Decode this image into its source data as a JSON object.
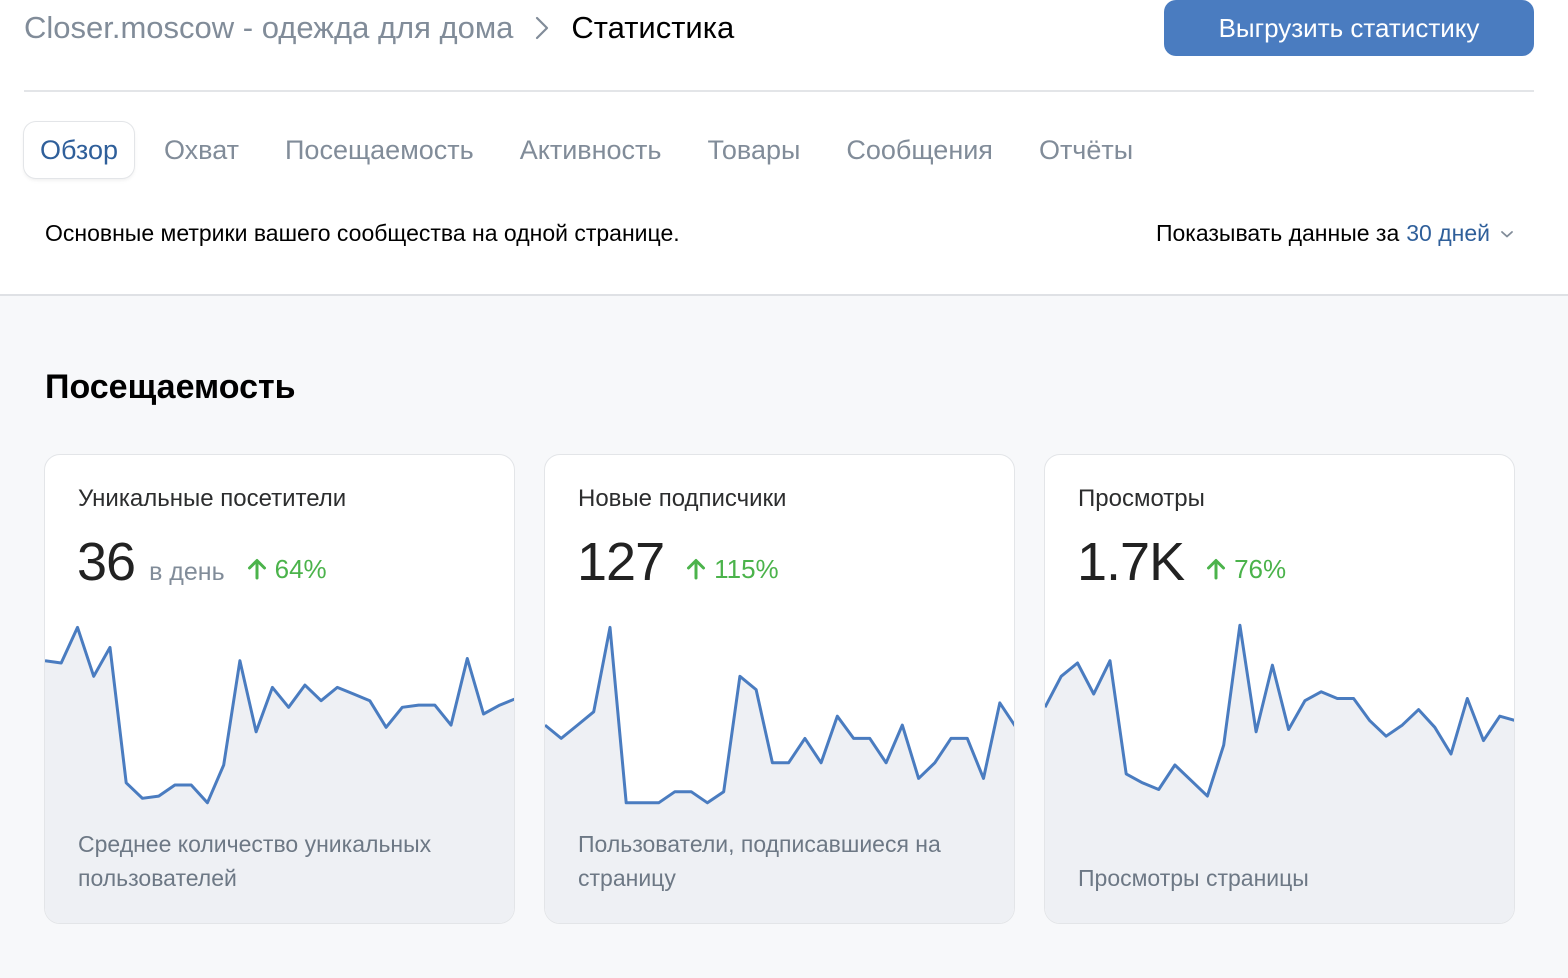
{
  "breadcrumb": {
    "parent": "Closer.moscow - одежда для дома",
    "current": "Статистика"
  },
  "export_button": "Выгрузить статистику",
  "tabs": [
    {
      "label": "Обзор",
      "active": true
    },
    {
      "label": "Охват",
      "active": false
    },
    {
      "label": "Посещаемость",
      "active": false
    },
    {
      "label": "Активность",
      "active": false
    },
    {
      "label": "Товары",
      "active": false
    },
    {
      "label": "Сообщения",
      "active": false
    },
    {
      "label": "Отчёты",
      "active": false
    }
  ],
  "subtitle": "Основные метрики вашего сообщества на одной странице.",
  "period": {
    "label": "Показывать данные за",
    "value": "30 дней"
  },
  "section_title": "Посещаемость",
  "colors": {
    "accent": "#4a7cc0",
    "positive": "#4bb34b",
    "line": "#4a7cc0",
    "fill": "#eef0f4"
  },
  "cards": [
    {
      "title": "Уникальные посетители",
      "value": "36",
      "unit": "в день",
      "change": "64%",
      "description": "Среднее количество уникальных пользователей"
    },
    {
      "title": "Новые подписчики",
      "value": "127",
      "unit": "",
      "change": "115%",
      "description": "Пользователи, подписавшиеся на страницу"
    },
    {
      "title": "Просмотры",
      "value": "1.7K",
      "unit": "",
      "change": "76%",
      "description": "Просмотры страницы"
    }
  ],
  "chart_data": [
    {
      "type": "area",
      "series": [
        {
          "values": [
            65,
            64,
            80,
            58,
            71,
            10,
            3,
            4,
            9,
            9,
            1,
            18,
            65,
            33,
            53,
            44,
            54,
            47,
            53,
            50,
            47,
            35,
            44,
            45,
            45,
            36,
            66,
            41,
            45,
            48
          ]
        }
      ]
    },
    {
      "type": "area",
      "series": [
        {
          "values": [
            36,
            30,
            36,
            42,
            80,
            1,
            1,
            1,
            6,
            6,
            1,
            6,
            58,
            52,
            19,
            19,
            30,
            19,
            40,
            30,
            30,
            19,
            36,
            12,
            19,
            30,
            30,
            12,
            46,
            35
          ]
        }
      ]
    },
    {
      "type": "area",
      "series": [
        {
          "values": [
            44,
            58,
            64,
            50,
            65,
            14,
            10,
            7,
            18,
            11,
            4,
            27,
            81,
            33,
            63,
            34,
            47,
            51,
            48,
            48,
            38,
            31,
            36,
            43,
            35,
            23,
            48,
            29,
            40,
            38
          ]
        }
      ]
    }
  ]
}
